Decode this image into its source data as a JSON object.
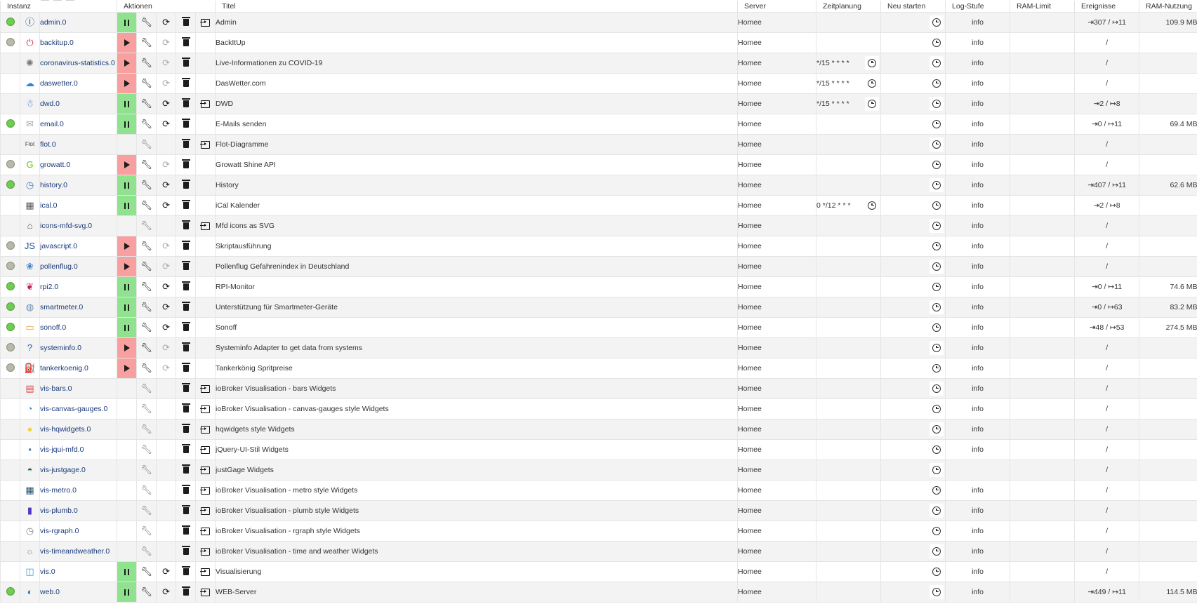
{
  "columns": {
    "instance": "Instanz",
    "actions": "Aktionen",
    "title": "Titel",
    "server": "Server",
    "schedule": "Zeitplanung",
    "restart": "Neu starten",
    "loglevel": "Log-Stufe",
    "ramlimit": "RAM-Limit",
    "events": "Ereignisse",
    "ramusage": "RAM-Nutzung"
  },
  "icons": {
    "pause": "pause-icon",
    "play": "play-icon",
    "settings": "wrench-icon",
    "restart": "reload-icon",
    "delete": "trash-icon",
    "open": "open-web-icon",
    "schedule": "clock-icon"
  },
  "colors": {
    "running": "#8fe38f",
    "stopped": "#f8a0a0",
    "status_green": "#6ccf4e",
    "status_grey": "#b9b9a7",
    "link": "#1a3a7a"
  },
  "rows": [
    {
      "name": "admin.0",
      "title": "Admin",
      "server": "Homee",
      "schedule": "",
      "log": "info",
      "events": "⇥307 / ↦11",
      "ram": "109.9 MB",
      "status": "green",
      "state": "pause",
      "settings": true,
      "restart": true,
      "link": true,
      "icon_color": "#1e4e91",
      "icon_text": "Ⓘ"
    },
    {
      "name": "backitup.0",
      "title": "BackItUp",
      "server": "Homee",
      "schedule": "",
      "log": "info",
      "events": "/",
      "ram": "",
      "status": "grey",
      "state": "play",
      "settings": true,
      "restart": false,
      "link": false,
      "icon_color": "#e0283c",
      "icon_text": "⏻"
    },
    {
      "name": "coronavirus-statistics.0",
      "title": "Live-Informationen zu COVID-19",
      "server": "Homee",
      "schedule": "*/15 * * * *",
      "log": "info",
      "events": "/",
      "ram": "",
      "status": "none",
      "state": "play",
      "settings": true,
      "restart": false,
      "link": false,
      "icon_color": "#7a7a7a",
      "icon_text": "✺"
    },
    {
      "name": "daswetter.0",
      "title": "DasWetter.com",
      "server": "Homee",
      "schedule": "*/15 * * * *",
      "log": "info",
      "events": "/",
      "ram": "",
      "status": "none",
      "state": "play",
      "settings": true,
      "restart": false,
      "link": false,
      "icon_color": "#2d84d8",
      "icon_text": "☁"
    },
    {
      "name": "dwd.0",
      "title": "DWD",
      "server": "Homee",
      "schedule": "*/15 * * * *",
      "log": "info",
      "events": "⇥2 / ↦8",
      "ram": "",
      "status": "none",
      "state": "pause",
      "settings": true,
      "restart": true,
      "link": true,
      "icon_color": "#3a78d6",
      "icon_text": "☃"
    },
    {
      "name": "email.0",
      "title": "E-Mails senden",
      "server": "Homee",
      "schedule": "",
      "log": "info",
      "events": "⇥0 / ↦11",
      "ram": "69.4 MB",
      "status": "green",
      "state": "pause",
      "settings": true,
      "restart": true,
      "link": false,
      "icon_color": "#9aa6b5",
      "icon_text": "✉"
    },
    {
      "name": "flot.0",
      "title": "Flot-Diagramme",
      "server": "Homee",
      "schedule": "",
      "log": "info",
      "events": "/",
      "ram": "",
      "status": "none",
      "state": "none",
      "settings": true,
      "restart": false,
      "link": true,
      "icon_color": "#444444",
      "icon_text": "Flot"
    },
    {
      "name": "growatt.0",
      "title": "Growatt Shine API",
      "server": "Homee",
      "schedule": "",
      "log": "info",
      "events": "/",
      "ram": "",
      "status": "grey",
      "state": "play",
      "settings": true,
      "restart": false,
      "link": false,
      "icon_color": "#6bbf2a",
      "icon_text": "G"
    },
    {
      "name": "history.0",
      "title": "History",
      "server": "Homee",
      "schedule": "",
      "log": "info",
      "events": "⇥407 / ↦11",
      "ram": "62.6 MB",
      "status": "green",
      "state": "pause",
      "settings": true,
      "restart": true,
      "link": false,
      "icon_color": "#4a7fb5",
      "icon_text": "◷"
    },
    {
      "name": "ical.0",
      "title": "iCal Kalender",
      "server": "Homee",
      "schedule": "0 */12 * * *",
      "log": "info",
      "events": "⇥2 / ↦8",
      "ram": "",
      "status": "none",
      "state": "pause",
      "settings": true,
      "restart": true,
      "link": false,
      "icon_color": "#5a5a5a",
      "icon_text": "▦"
    },
    {
      "name": "icons-mfd-svg.0",
      "title": "Mfd icons as SVG",
      "server": "Homee",
      "schedule": "",
      "log": "info",
      "events": "/",
      "ram": "",
      "status": "none",
      "state": "none",
      "settings": true,
      "restart": false,
      "link": true,
      "icon_color": "#555555",
      "icon_text": "⌂"
    },
    {
      "name": "javascript.0",
      "title": "Skriptausführung",
      "server": "Homee",
      "schedule": "",
      "log": "info",
      "events": "/",
      "ram": "",
      "status": "grey",
      "state": "play",
      "settings": true,
      "restart": false,
      "link": false,
      "icon_color": "#1f4f8f",
      "icon_text": "JS"
    },
    {
      "name": "pollenflug.0",
      "title": "Pollenflug Gefahrenindex in Deutschland",
      "server": "Homee",
      "schedule": "",
      "log": "info",
      "events": "/",
      "ram": "",
      "status": "grey",
      "state": "play",
      "settings": true,
      "restart": false,
      "link": false,
      "icon_color": "#3a7fc8",
      "icon_text": "❀"
    },
    {
      "name": "rpi2.0",
      "title": "RPI-Monitor",
      "server": "Homee",
      "schedule": "",
      "log": "info",
      "events": "⇥0 / ↦11",
      "ram": "74.6 MB",
      "status": "green",
      "state": "pause",
      "settings": true,
      "restart": true,
      "link": false,
      "icon_color": "#c2185b",
      "icon_text": "❦"
    },
    {
      "name": "smartmeter.0",
      "title": "Unterstützung für Smartmeter-Geräte",
      "server": "Homee",
      "schedule": "",
      "log": "info",
      "events": "⇥0 / ↦63",
      "ram": "83.2 MB",
      "status": "green",
      "state": "pause",
      "settings": true,
      "restart": true,
      "link": false,
      "icon_color": "#6a8fb8",
      "icon_text": "◍"
    },
    {
      "name": "sonoff.0",
      "title": "Sonoff",
      "server": "Homee",
      "schedule": "",
      "log": "info",
      "events": "⇥48 / ↦53",
      "ram": "274.5 MB",
      "status": "green",
      "state": "pause",
      "settings": true,
      "restart": true,
      "link": false,
      "icon_color": "#f0a030",
      "icon_text": "▭"
    },
    {
      "name": "systeminfo.0",
      "title": "Systeminfo Adapter to get data from systems",
      "server": "Homee",
      "schedule": "",
      "log": "info",
      "events": "/",
      "ram": "",
      "status": "grey",
      "state": "play",
      "settings": true,
      "restart": false,
      "link": false,
      "icon_color": "#1f5fb0",
      "icon_text": "?"
    },
    {
      "name": "tankerkoenig.0",
      "title": "Tankerkönig Spritpreise",
      "server": "Homee",
      "schedule": "",
      "log": "info",
      "events": "/",
      "ram": "",
      "status": "grey",
      "state": "play",
      "settings": true,
      "restart": false,
      "link": false,
      "icon_color": "#333333",
      "icon_text": "⛽"
    },
    {
      "name": "vis-bars.0",
      "title": "ioBroker Visualisation - bars Widgets",
      "server": "Homee",
      "schedule": "",
      "log": "info",
      "events": "/",
      "ram": "",
      "status": "none",
      "state": "none",
      "settings": true,
      "restart": false,
      "link": true,
      "icon_color": "#e04848",
      "icon_text": "▤"
    },
    {
      "name": "vis-canvas-gauges.0",
      "title": "ioBroker Visualisation - canvas-gauges style Widgets",
      "server": "Homee",
      "schedule": "",
      "log": "info",
      "events": "/",
      "ram": "",
      "status": "none",
      "state": "none",
      "settings": true,
      "restart": false,
      "link": true,
      "icon_color": "#3a7fc8",
      "icon_text": "◔"
    },
    {
      "name": "vis-hqwidgets.0",
      "title": "hqwidgets style Widgets",
      "server": "Homee",
      "schedule": "",
      "log": "info",
      "events": "/",
      "ram": "",
      "status": "none",
      "state": "none",
      "settings": true,
      "restart": false,
      "link": true,
      "icon_color": "#f1d04a",
      "icon_text": "●"
    },
    {
      "name": "vis-jqui-mfd.0",
      "title": "jQuery-UI-Stil Widgets",
      "server": "Homee",
      "schedule": "",
      "log": "info",
      "events": "/",
      "ram": "",
      "status": "none",
      "state": "none",
      "settings": true,
      "restart": false,
      "link": true,
      "icon_color": "#5b7fa8",
      "icon_text": "▪"
    },
    {
      "name": "vis-justgage.0",
      "title": "justGage Widgets",
      "server": "Homee",
      "schedule": "",
      "log": "",
      "events": "/",
      "ram": "",
      "status": "none",
      "state": "none",
      "settings": true,
      "restart": false,
      "link": true,
      "icon_color": "#1f6f3f",
      "icon_text": "◓"
    },
    {
      "name": "vis-metro.0",
      "title": "ioBroker Visualisation - metro style Widgets",
      "server": "Homee",
      "schedule": "",
      "log": "info",
      "events": "/",
      "ram": "",
      "status": "none",
      "state": "none",
      "settings": true,
      "restart": false,
      "link": true,
      "icon_color": "#1f4f6f",
      "icon_text": "▦"
    },
    {
      "name": "vis-plumb.0",
      "title": "ioBroker Visualisation - plumb style Widgets",
      "server": "Homee",
      "schedule": "",
      "log": "info",
      "events": "/",
      "ram": "",
      "status": "none",
      "state": "none",
      "settings": true,
      "restart": false,
      "link": true,
      "icon_color": "#4a3ac8",
      "icon_text": "▮"
    },
    {
      "name": "vis-rgraph.0",
      "title": "ioBroker Visualisation - rgraph style Widgets",
      "server": "Homee",
      "schedule": "",
      "log": "info",
      "events": "/",
      "ram": "",
      "status": "none",
      "state": "none",
      "settings": true,
      "restart": false,
      "link": true,
      "icon_color": "#8a8a8a",
      "icon_text": "◷"
    },
    {
      "name": "vis-timeandweather.0",
      "title": "ioBroker Visualisation - time and weather Widgets",
      "server": "Homee",
      "schedule": "",
      "log": "info",
      "events": "/",
      "ram": "",
      "status": "none",
      "state": "none",
      "settings": true,
      "restart": false,
      "link": true,
      "icon_color": "#9a9a9a",
      "icon_text": "☼"
    },
    {
      "name": "vis.0",
      "title": "Visualisierung",
      "server": "Homee",
      "schedule": "",
      "log": "info",
      "events": "/",
      "ram": "",
      "status": "none",
      "state": "pause",
      "settings": true,
      "restart": true,
      "link": true,
      "icon_color": "#3a9ad8",
      "icon_text": "◫"
    },
    {
      "name": "web.0",
      "title": "WEB-Server",
      "server": "Homee",
      "schedule": "",
      "log": "info",
      "events": "⇥449 / ↦11",
      "ram": "114.5 MB",
      "status": "green",
      "state": "pause",
      "settings": true,
      "restart": true,
      "link": true,
      "icon_color": "#3a6ab8",
      "icon_text": "◐"
    }
  ]
}
